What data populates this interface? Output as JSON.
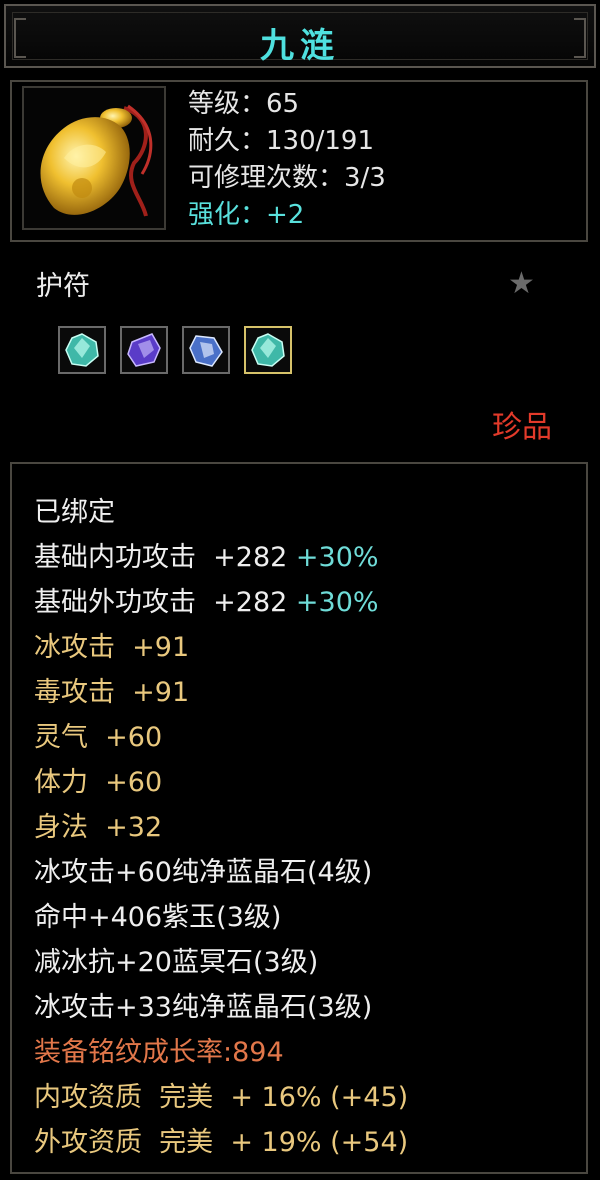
{
  "item": {
    "name": "九涟",
    "level": "等级：65",
    "durability": "耐久：130/191",
    "repairs": "可修理次数：3/3",
    "enhance": "强化：+2",
    "type": "护符",
    "rarity": "珍品",
    "icon": "jade-pendant-icon",
    "star_icon": "star-icon",
    "gem_slots": [
      {
        "icon": "green-gem-icon"
      },
      {
        "icon": "purple-gem-icon"
      },
      {
        "icon": "blue-gem-icon"
      },
      {
        "icon": "green-gem-icon"
      }
    ]
  },
  "attributes": {
    "bound": "已绑定",
    "base_inner_label": "基础内功攻击  +282 ",
    "base_inner_bonus": "+30%",
    "base_outer_label": "基础外功攻击  +282 ",
    "base_outer_bonus": "+30%",
    "ice_attack": "冰攻击  +91",
    "poison_attack": "毒攻击  +91",
    "spirit": "灵气  +60",
    "stamina": "体力  +60",
    "agility": "身法  +32",
    "gem1": "冰攻击+60纯净蓝晶石(4级)",
    "gem2": "命中+406紫玉(3级)",
    "gem3": "减冰抗+20蓝冥石(3级)",
    "gem4": "冰攻击+33纯净蓝晶石(3级)",
    "growth": "装备铭纹成长率:894",
    "inner_quality": "内攻资质  完美  + 16% (+45)",
    "outer_quality": "外攻资质  完美  + 19% (+54)"
  },
  "colors": {
    "title": "#4fe0df",
    "white": "#efefef",
    "gold": "#e9c87e",
    "cyan": "#6fdcd8",
    "orange": "#e2774a",
    "rarity": "#e23a2a"
  }
}
